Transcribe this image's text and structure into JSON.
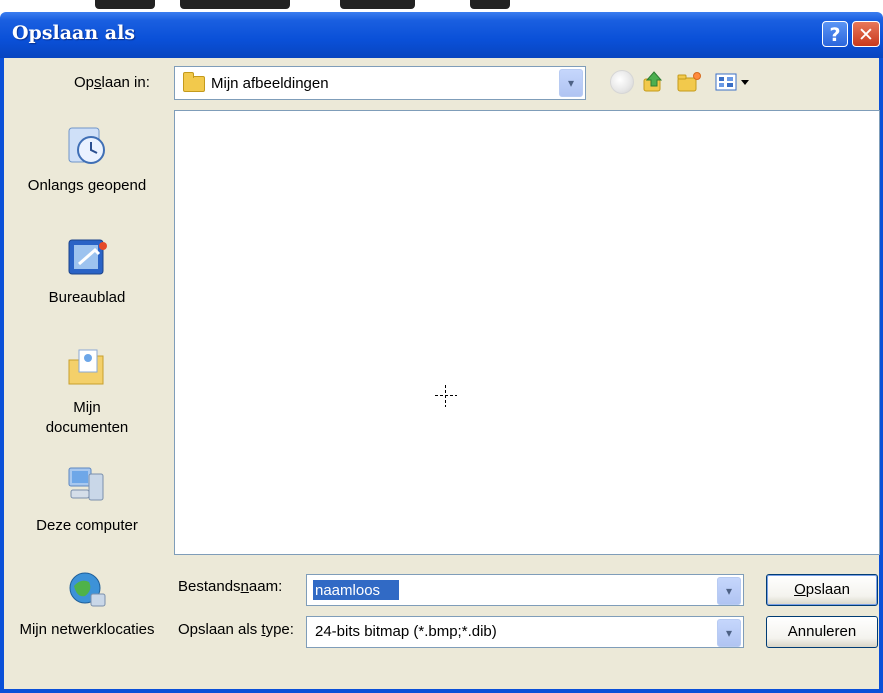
{
  "window": {
    "title": "Opslaan als",
    "help_glyph": "?",
    "close_glyph": "✕"
  },
  "lookin": {
    "label_pre": "Op",
    "label_u": "s",
    "label_post": "laan in:",
    "value": "Mijn afbeeldingen",
    "dropdown_glyph": "▾"
  },
  "places": [
    {
      "label": "Onlangs geopend",
      "icon": "recent-icon"
    },
    {
      "label": "Bureaublad",
      "icon": "desktop-icon"
    },
    {
      "label": "Mijn documenten",
      "icon": "my-documents-icon"
    },
    {
      "label": "Deze computer",
      "icon": "my-computer-icon"
    },
    {
      "label": "Mijn netwerklocaties",
      "icon": "network-icon"
    }
  ],
  "filename": {
    "label_pre": "Bestands",
    "label_u": "n",
    "label_post": "aam:",
    "value": "naamloos"
  },
  "filetype": {
    "label_pre": "Opslaan als ",
    "label_u": "t",
    "label_post": "ype:",
    "value": "24-bits bitmap (*.bmp;*.dib)"
  },
  "buttons": {
    "save_u": "O",
    "save_rest": "pslaan",
    "cancel": "Annuleren"
  },
  "colors": {
    "titlebar": "#0a50d8",
    "dialog_bg": "#ece9d8",
    "selection": "#316ac5",
    "close": "#c8391c"
  }
}
